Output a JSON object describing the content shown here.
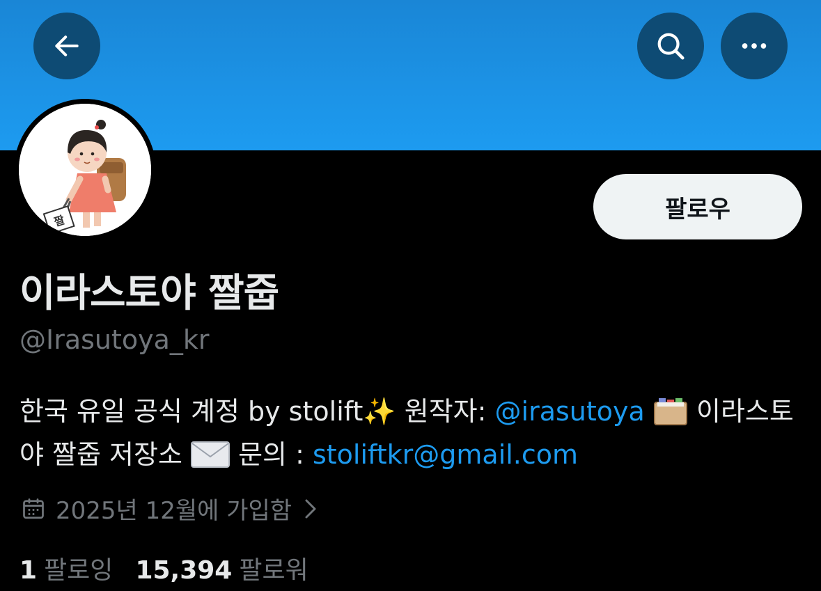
{
  "header": {
    "back_icon": "arrow-left-icon",
    "search_icon": "search-icon",
    "more_icon": "more-horizontal-icon",
    "banner_color": "#1d9bf0"
  },
  "profile": {
    "display_name": "이라스토야 짤줍",
    "handle": "@Irasutoya_kr",
    "follow_label": "팔로우",
    "avatar_sign_text": "짤",
    "bio": {
      "part1": "한국 유일 공식 계정 by stolift",
      "sparkle": "✨",
      "part2": " 원작자: ",
      "mention": "@irasutoya",
      "part3": " 이라스토야 짤줍 저장소 ",
      "part4": " 문의 : ",
      "email": "stoliftkr@gmail.com"
    },
    "joined": "2025년 12월에 가입함",
    "stats": {
      "following_count": "1",
      "following_label": "팔로잉",
      "followers_count": "15,394",
      "followers_label": "팔로워"
    }
  },
  "colors": {
    "accent": "#1d9bf0",
    "secondary_text": "#71767b",
    "primary_text": "#e7e9ea",
    "header_button_bg": "#0e4b74"
  }
}
